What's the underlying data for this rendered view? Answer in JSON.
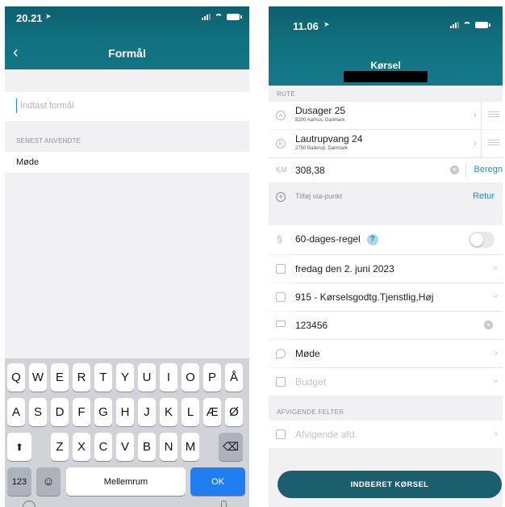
{
  "left": {
    "status": {
      "time": "20.21"
    },
    "title": "Formål",
    "purpose_placeholder": "Indtast formål",
    "recent_label": "SENEST ANVENDTE",
    "recent_items": [
      "Møde"
    ],
    "keyboard": {
      "row1": [
        "Q",
        "W",
        "E",
        "R",
        "T",
        "Y",
        "U",
        "I",
        "O",
        "P",
        "Å"
      ],
      "row2": [
        "A",
        "S",
        "D",
        "F",
        "G",
        "H",
        "J",
        "K",
        "L",
        "Æ",
        "Ø"
      ],
      "row3": [
        "Z",
        "X",
        "C",
        "V",
        "B",
        "N",
        "M"
      ],
      "shift": "⬆",
      "backspace": "⌫",
      "numbers": "123",
      "emoji": "☺",
      "space": "Mellemrum",
      "ok": "OK"
    }
  },
  "right": {
    "status": {
      "time": "11.06"
    },
    "title": "Kørsel",
    "route_label": "RUTE",
    "stops": [
      {
        "marker": "A",
        "name": "Dusager 25",
        "address": "8200 Aarhus, Danmark"
      },
      {
        "marker": "B",
        "name": "Lautrupvang 24",
        "address": "2750 Ballerup, Danmark"
      }
    ],
    "km_label": "KM",
    "km_value": "308,38",
    "calculate": "Beregn",
    "add_via": "Tilføj via-punkt",
    "return": "Retur",
    "rule_60": "60-dages-regel",
    "rule_60_help": "?",
    "rule_60_on": false,
    "date": "fredag den 2. juni 2023",
    "rate": "915 - Kørselsgodtg.Tjenstlig,Høj",
    "plate": "123456",
    "purpose": "Møde",
    "budget": "Budget",
    "deviating_label": "AFVIGENDE FELTER",
    "deviating_dept": "Afvigende afd.",
    "submit": "INDBERET KØRSEL"
  },
  "colors": {
    "header": "#137684",
    "accent": "#1a8fd1",
    "submit": "#1b5f6e",
    "ok_key": "#1f7ff0"
  }
}
